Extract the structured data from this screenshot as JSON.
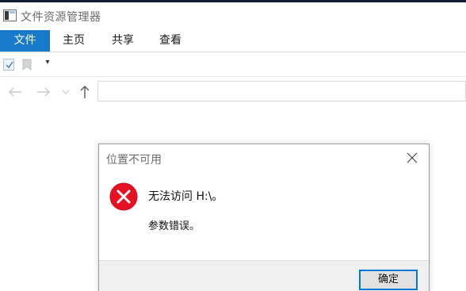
{
  "window": {
    "title": "文件资源管理器"
  },
  "ribbon": {
    "tabs": [
      {
        "label": "文件"
      },
      {
        "label": "主页"
      },
      {
        "label": "共享"
      },
      {
        "label": "查看"
      }
    ]
  },
  "quick_access": {
    "dropdown_glyph": "▾"
  },
  "nav": {
    "back_glyph": "←",
    "forward_glyph": "→",
    "recent_glyph": "⌄",
    "up_glyph": "↑",
    "address_value": ""
  },
  "dialog": {
    "title": "位置不可用",
    "message": "无法访问 H:\\。",
    "detail": "参数错误。",
    "ok_label": "确定"
  },
  "colors": {
    "accent": "#1979ca",
    "error_red": "#e81123",
    "focus_border": "#0078d7"
  }
}
